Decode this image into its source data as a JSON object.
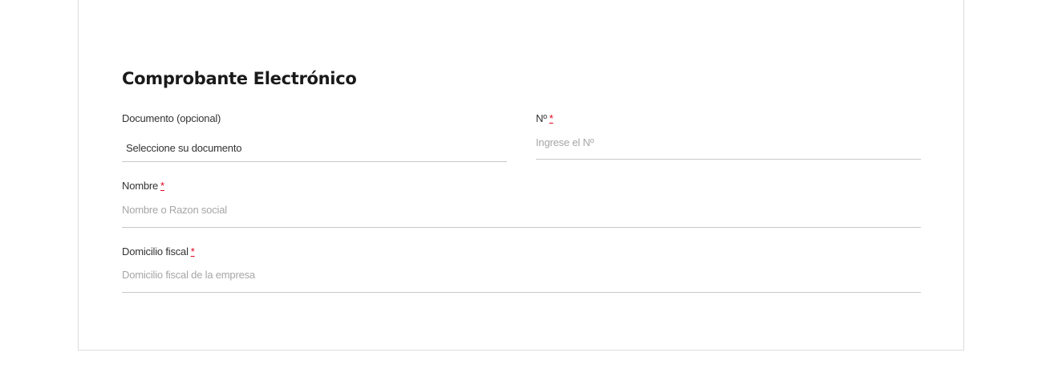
{
  "section": {
    "title": "Comprobante Electrónico"
  },
  "form": {
    "documento": {
      "label": "Documento (opcional)",
      "selected_value": "Seleccione su documento"
    },
    "numero": {
      "label": "Nº",
      "required_mark": "*",
      "placeholder": "Ingrese el Nº",
      "value": ""
    },
    "nombre": {
      "label": "Nombre",
      "required_mark": "*",
      "placeholder": "Nombre o Razon social",
      "value": ""
    },
    "domicilio": {
      "label": "Domicilio fiscal",
      "required_mark": "*",
      "placeholder": "Domicilio fiscal de la empresa",
      "value": ""
    }
  },
  "colors": {
    "required": "#e2001a",
    "border": "#c8c8c8",
    "placeholder": "#a6a6a6"
  }
}
